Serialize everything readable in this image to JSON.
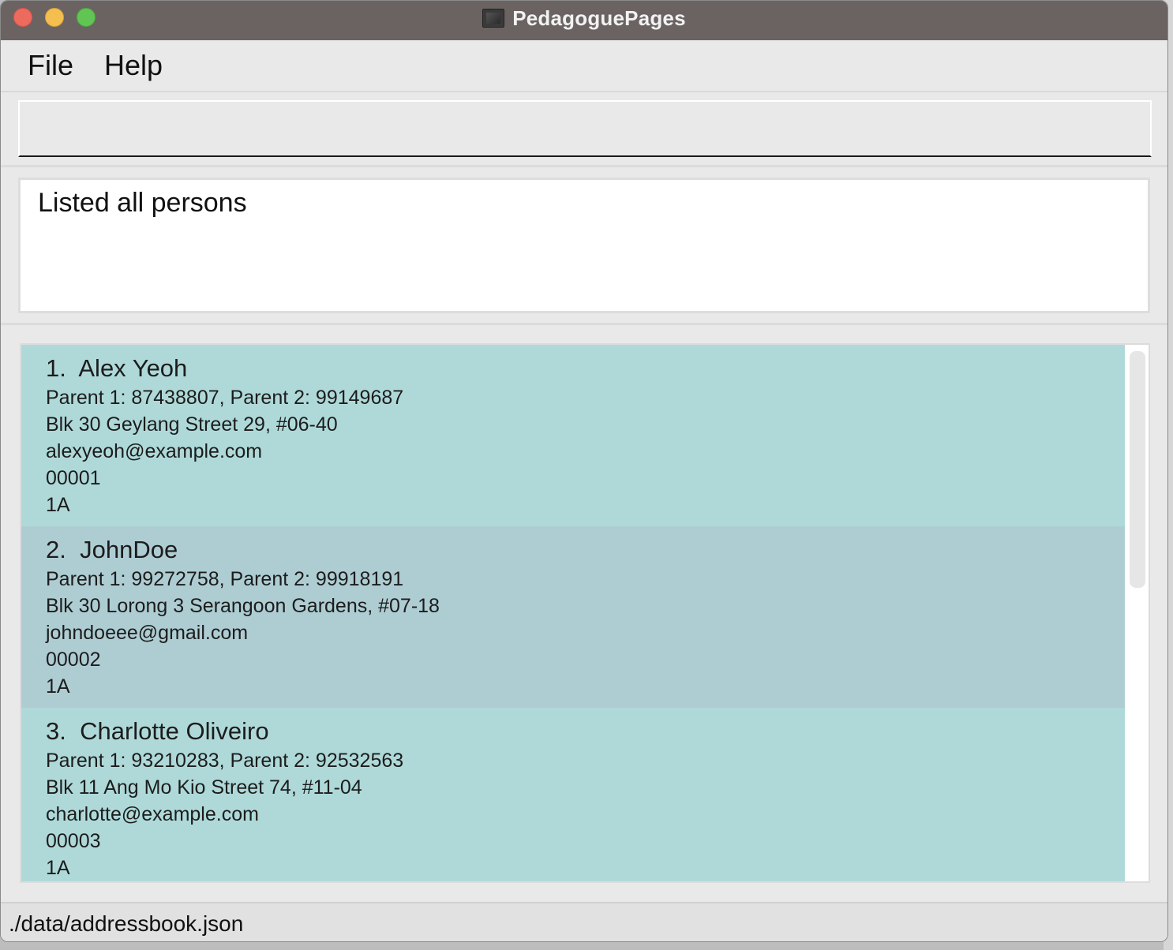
{
  "window": {
    "title": "PedagoguePages",
    "app_icon": "app-icon"
  },
  "menu": {
    "file": "File",
    "help": "Help"
  },
  "command": {
    "value": "",
    "placeholder": ""
  },
  "result": {
    "message": "Listed all persons"
  },
  "persons": [
    {
      "index": "1.",
      "name": "Alex Yeoh",
      "parents": "Parent 1: 87438807, Parent 2: 99149687",
      "address": "Blk 30 Geylang Street 29, #06-40",
      "email": "alexyeoh@example.com",
      "student_id": "00001",
      "class": "1A"
    },
    {
      "index": "2.",
      "name": "JohnDoe",
      "parents": "Parent 1: 99272758, Parent 2: 99918191",
      "address": "Blk 30 Lorong 3 Serangoon Gardens, #07-18",
      "email": "johndoeee@gmail.com",
      "student_id": "00002",
      "class": "1A"
    },
    {
      "index": "3.",
      "name": "Charlotte Oliveiro",
      "parents": "Parent 1: 93210283, Parent 2: 92532563",
      "address": "Blk 11 Ang Mo Kio Street 74, #11-04",
      "email": "charlotte@example.com",
      "student_id": "00003",
      "class": "1A"
    }
  ],
  "status": {
    "file_path": "./data/addressbook.json"
  },
  "colors": {
    "card_odd": "#afd9d9",
    "card_even": "#aecdd3",
    "titlebar": "#6b6362"
  }
}
